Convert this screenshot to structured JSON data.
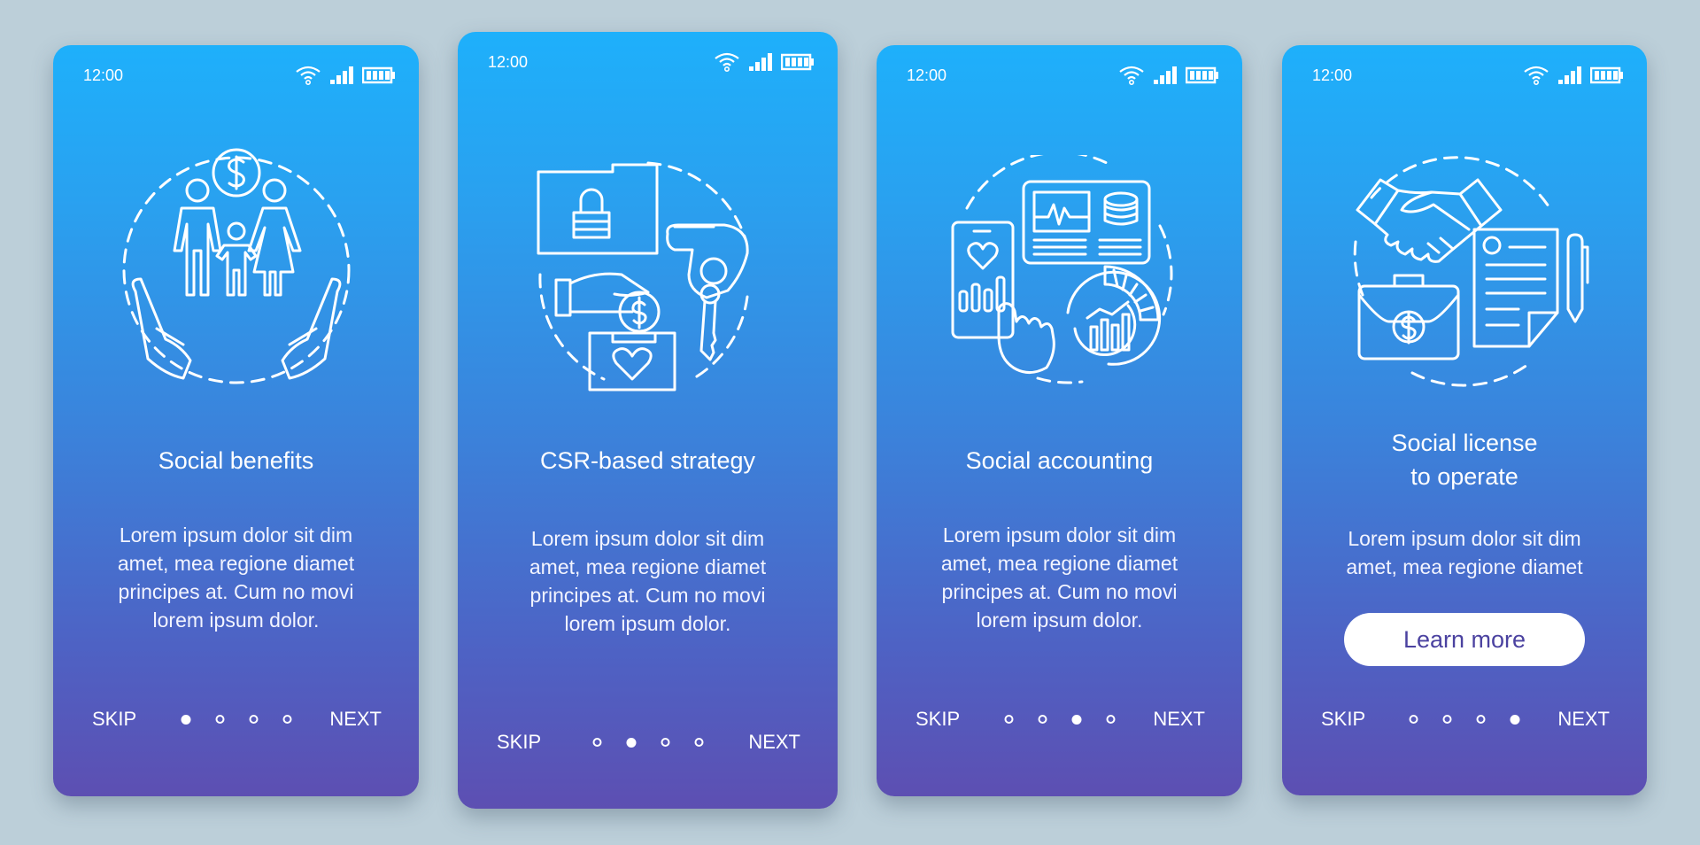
{
  "background_color": "#bccfd9",
  "status_bar": {
    "time": "12:00",
    "icons": [
      "wifi-icon",
      "signal-icon",
      "battery-icon"
    ]
  },
  "cards": [
    {
      "title": "Social benefits",
      "body": "Lorem ipsum dolor sit dim\namet, mea regione diamet\nprincipes at. Cum no movi\nlorem ipsum dolor.",
      "illustration": "family-in-hands-icon",
      "active_page": 1,
      "skip": "SKIP",
      "next": "NEXT"
    },
    {
      "title": "CSR-based strategy",
      "body": "Lorem ipsum dolor sit dim\namet, mea regione diamet\nprincipes at. Cum no movi\nlorem ipsum dolor.",
      "illustration": "donation-and-key-icon",
      "active_page": 2,
      "skip": "SKIP",
      "next": "NEXT"
    },
    {
      "title": "Social accounting",
      "body": "Lorem ipsum dolor sit dim\namet, mea regione diamet\nprincipes at. Cum no movi\nlorem ipsum dolor.",
      "illustration": "analytics-dashboard-icon",
      "active_page": 3,
      "skip": "SKIP",
      "next": "NEXT"
    },
    {
      "title": "Social license\nto operate",
      "body": "Lorem ipsum dolor sit dim\namet, mea regione diamet",
      "illustration": "handshake-contract-icon",
      "button": "Learn more",
      "active_page": 4,
      "skip": "SKIP",
      "next": "NEXT"
    }
  ],
  "page_count": 4
}
